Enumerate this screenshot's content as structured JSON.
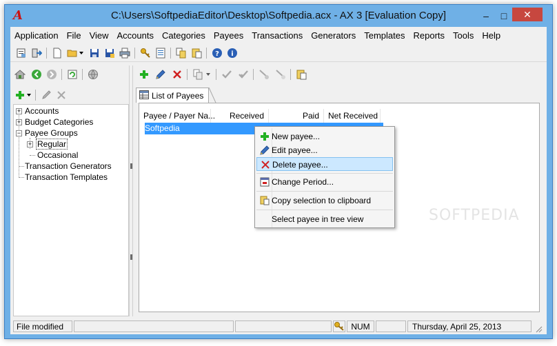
{
  "window": {
    "title": "C:\\Users\\SoftpediaEditor\\Desktop\\Softpedia.acx - AX 3 [Evaluation Copy]",
    "logo_text": "A",
    "min_glyph": "–",
    "max_glyph": "□",
    "close_glyph": "✕"
  },
  "menu": [
    "Application",
    "File",
    "View",
    "Accounts",
    "Categories",
    "Payees",
    "Transactions",
    "Generators",
    "Templates",
    "Reports",
    "Tools",
    "Help"
  ],
  "tree": {
    "items": [
      {
        "label": "Accounts"
      },
      {
        "label": "Budget Categories"
      },
      {
        "label": "Payee Groups"
      },
      {
        "label": "Regular"
      },
      {
        "label": "Occasional"
      },
      {
        "label": "Transaction Generators"
      },
      {
        "label": "Transaction Templates"
      }
    ]
  },
  "tab": {
    "label": "List of Payees"
  },
  "list": {
    "columns": [
      "Payee / Payer Na...",
      "Received",
      "Paid",
      "Net Received"
    ],
    "rows": [
      {
        "payee": "Softpedia"
      }
    ]
  },
  "watermark": "SOFTPEDIA",
  "context_menu": {
    "items": [
      {
        "label": "New payee...",
        "icon": "plus-icon"
      },
      {
        "label": "Edit payee...",
        "icon": "pen-icon"
      },
      {
        "label": "Delete payee...",
        "icon": "cross-icon"
      },
      {
        "label": "Change Period...",
        "icon": "calendar-icon"
      },
      {
        "label": "Copy selection to clipboard",
        "icon": "clipboard-icon"
      },
      {
        "label": "Select payee in tree view",
        "icon": ""
      }
    ]
  },
  "status": {
    "left": "File modified",
    "num": "NUM",
    "date": "Thursday, April 25, 2013"
  },
  "colors": {
    "titlebar": "#6fb0e6",
    "selection": "#3399ff",
    "close": "#c7473f"
  }
}
